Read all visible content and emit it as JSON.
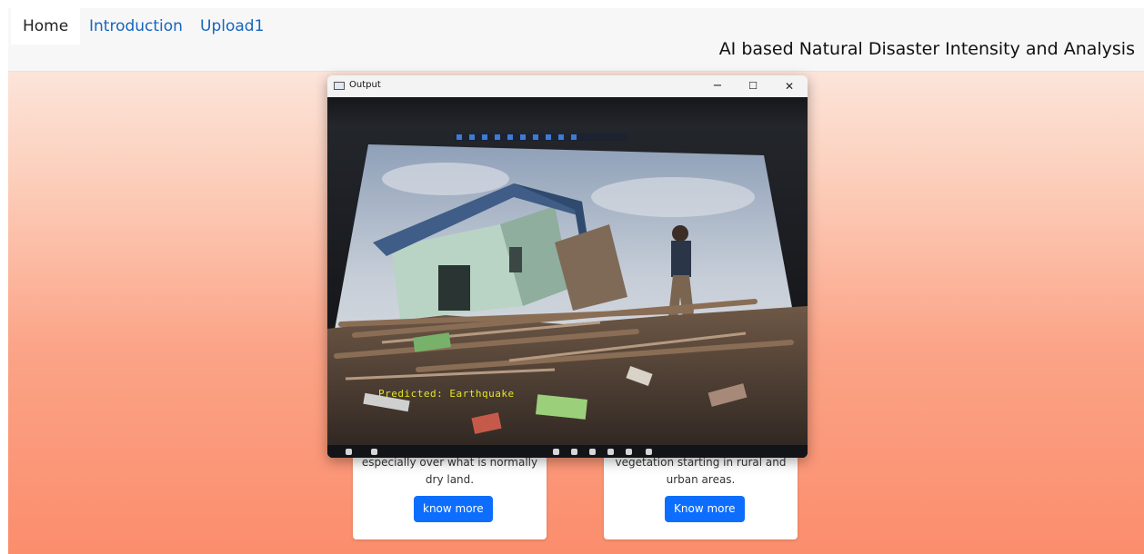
{
  "navbar": {
    "links": [
      {
        "label": "Home",
        "active": true
      },
      {
        "label": "Introduction",
        "active": false
      },
      {
        "label": "Upload1",
        "active": false
      }
    ],
    "title": "AI based Natural Disaster Intensity and Analysis"
  },
  "cards": [
    {
      "text_line1": "especially over what is normally",
      "text_line2": "dry land.",
      "button": "know more"
    },
    {
      "text_line1": "vegetation starting in rural and",
      "text_line2": "urban areas.",
      "button": "Know more"
    }
  ],
  "output_window": {
    "title": "Output",
    "minimize": "−",
    "maximize": "☐",
    "close": "✕",
    "detection_label": "Predicted: Earthquake"
  },
  "colors": {
    "link": "#1565c0",
    "button": "#0d6efd",
    "gradient_top": "#fdf1ec",
    "gradient_bottom": "#fb8d6c",
    "detection_text": "#e3e622"
  }
}
